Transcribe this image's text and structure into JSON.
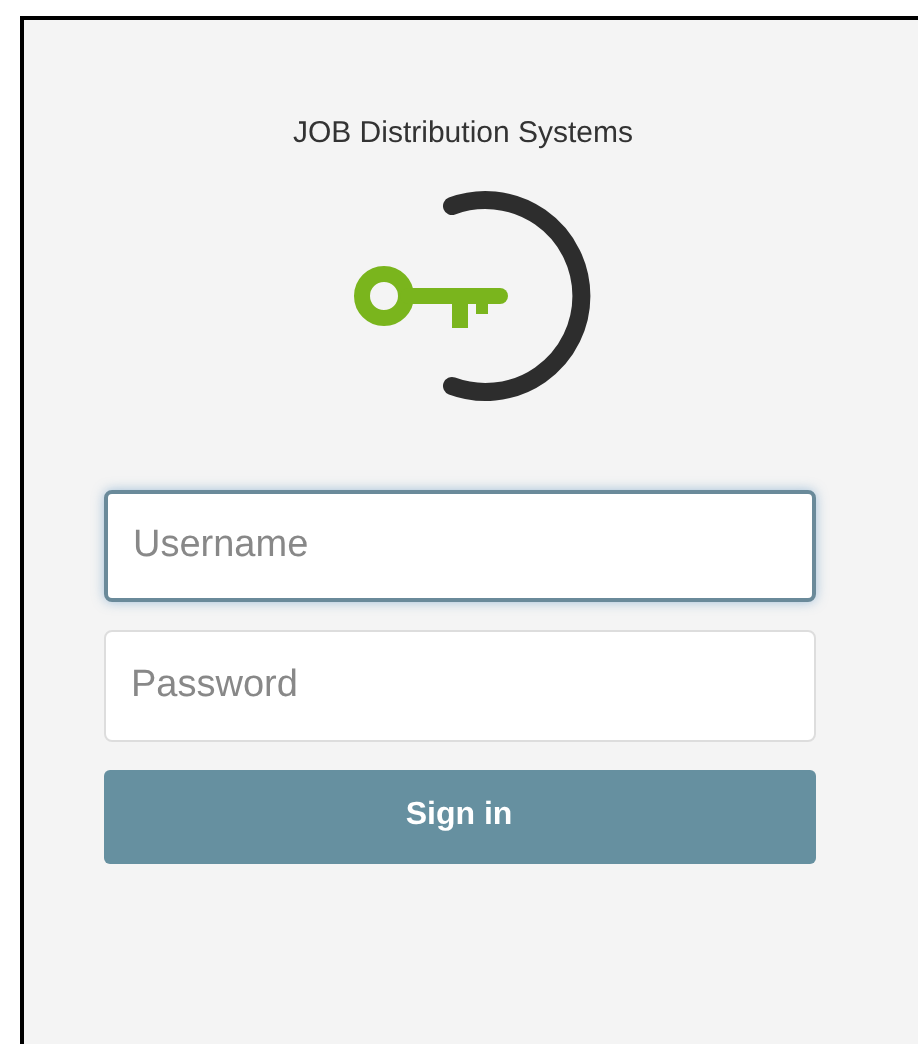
{
  "app": {
    "title": "JOB Distribution Systems"
  },
  "fields": [
    {
      "placeholder": "Username",
      "focused": true
    },
    {
      "placeholder": "Password",
      "focused": false
    }
  ],
  "button": {
    "label": "Sign in"
  }
}
